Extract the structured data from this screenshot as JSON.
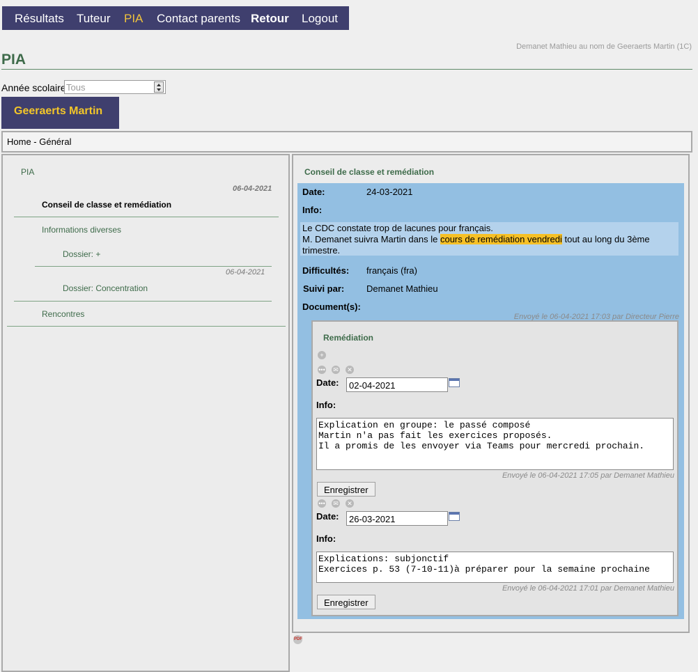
{
  "nav": {
    "items": [
      {
        "label": "Résultats"
      },
      {
        "label": "Tuteur"
      },
      {
        "label": "PIA"
      },
      {
        "label": "Contact parents"
      },
      {
        "label": "Retour"
      },
      {
        "label": "Logout"
      }
    ],
    "active": "PIA"
  },
  "user_info": "Demanet Mathieu au nom de Geeraerts Martin (1C)",
  "page_title": "PIA",
  "year": {
    "label": "Année scolaire",
    "value": "Tous"
  },
  "student_name": "Geeraerts Martin",
  "breadcrumb": "Home - Général",
  "left": {
    "pia": "PIA",
    "date1": "06-04-2021",
    "conseil": "Conseil de classe et remédiation",
    "info_diverses": "Informations diverses",
    "dossier_plus": "Dossier: +",
    "date2": "06-04-2021",
    "dossier_concentration": "Dossier: Concentration",
    "rencontres": "Rencontres"
  },
  "right": {
    "section_title": "Conseil de classe et remédiation",
    "date_label": "Date:",
    "date_value": "24-03-2021",
    "info_label": "Info:",
    "info_line1": "Le CDC constate trop de lacunes pour français.",
    "info_line2_pre": "M. Demanet suivra Martin dans le ",
    "info_line2_hl": "cours de remédiation vendredi",
    "info_line2_post": " tout au long du 3ème",
    "info_line3": "trimestre.",
    "difficultes_label": "Difficultés:",
    "difficultes_value": "français (fra)",
    "suivi_label": "Suivi par:",
    "suivi_value": "Demanet Mathieu",
    "documents_label": "Document(s):",
    "sent_meta": "Envoyé le 06-04-2021 17:03 par Directeur Pierre"
  },
  "remediation": {
    "title": "Remédiation",
    "entries": [
      {
        "date_label": "Date:",
        "date_value": "02-04-2021",
        "info_label": "Info:",
        "lines": [
          "Explication en groupe: le passé composé",
          "Martin n'a pas fait les exercices proposés.",
          "Il a promis de les envoyer via Teams pour mercredi prochain."
        ],
        "meta": "Envoyé le 06-04-2021 17:05 par Demanet Mathieu",
        "button": "Enregistrer"
      },
      {
        "date_label": "Date:",
        "date_value": "26-03-2021",
        "info_label": "Info:",
        "lines": [
          "Explications: subjonctif",
          "Exercices p. 53 (7-10-11)à préparer pour la semaine prochaine"
        ],
        "meta": "Envoyé le 06-04-2021 17:01 par Demanet Mathieu",
        "button": "Enregistrer"
      }
    ]
  },
  "icons": {
    "add": "plus-icon",
    "comment": "comment-icon",
    "mail": "mail-icon",
    "delete": "delete-icon",
    "calendar": "calendar-icon",
    "pdf": "pdf-icon"
  },
  "colors": {
    "nav_bg": "#3f3f6e",
    "nav_active": "#f0c33c",
    "student_name": "#f3c629",
    "green": "#3e6b4a",
    "blue_box": "#93bfe2",
    "highlight": "#f6c026"
  }
}
